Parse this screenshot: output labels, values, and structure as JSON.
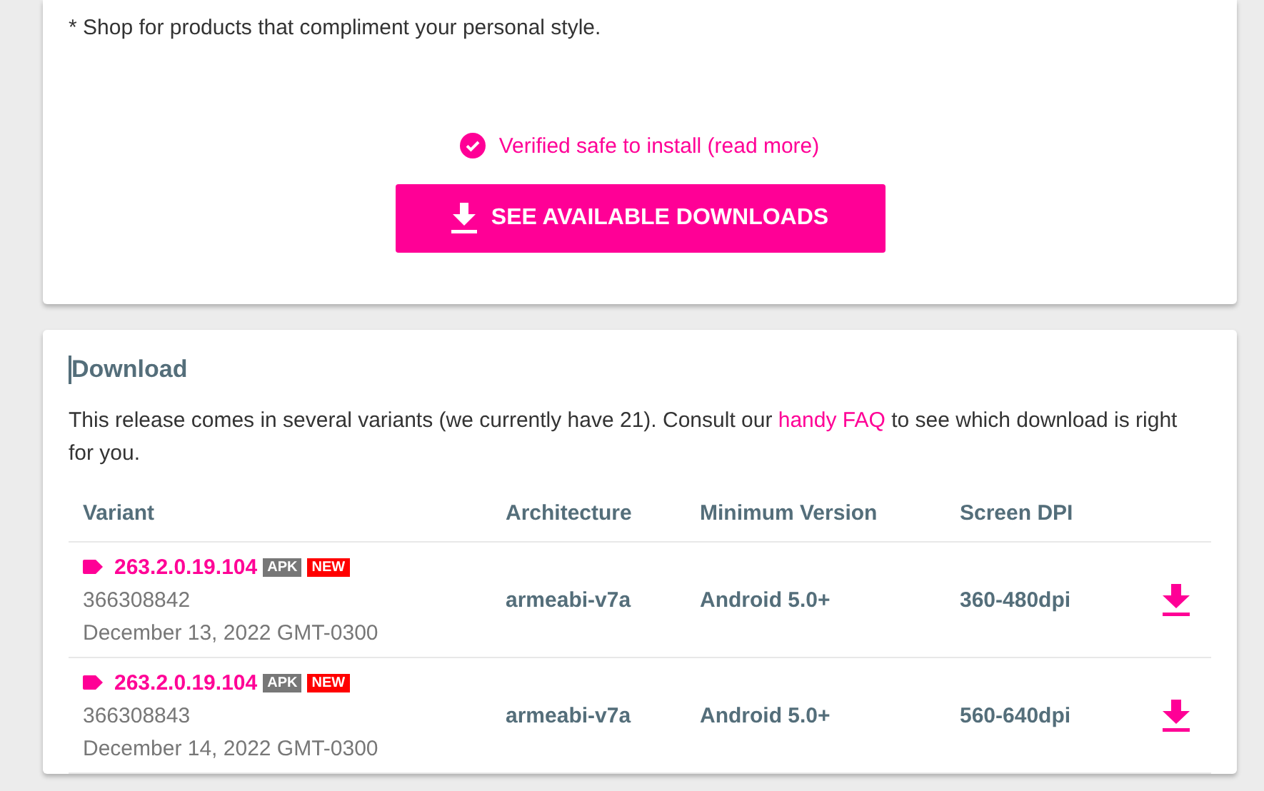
{
  "description_lines": [
    "* Shop for products that compliment your personal style."
  ],
  "verified": {
    "text": "Verified safe to install (read more)"
  },
  "download_button": {
    "label": "SEE AVAILABLE DOWNLOADS"
  },
  "download_section": {
    "title": "Download",
    "intro_before": "This release comes in several variants (we currently have 21). Consult our ",
    "intro_link": "handy FAQ",
    "intro_after": " to see which download is right for you.",
    "columns": [
      "Variant",
      "Architecture",
      "Minimum Version",
      "Screen DPI"
    ],
    "rows": [
      {
        "version": "263.2.0.19.104",
        "badges": [
          {
            "kind": "apk",
            "label": "APK"
          },
          {
            "kind": "new",
            "label": "NEW"
          }
        ],
        "code": "366308842",
        "date": "December 13, 2022 GMT-0300",
        "architecture": "armeabi-v7a",
        "min_version": "Android 5.0+",
        "dpi": "360-480dpi"
      },
      {
        "version": "263.2.0.19.104",
        "badges": [
          {
            "kind": "apk",
            "label": "APK"
          },
          {
            "kind": "new",
            "label": "NEW"
          }
        ],
        "code": "366308843",
        "date": "December 14, 2022 GMT-0300",
        "architecture": "armeabi-v7a",
        "min_version": "Android 5.0+",
        "dpi": "560-640dpi"
      }
    ]
  }
}
